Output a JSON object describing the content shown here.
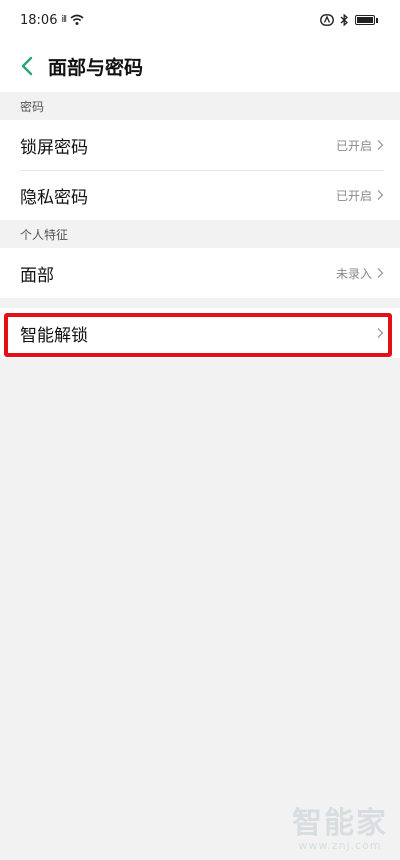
{
  "status_bar": {
    "time": "18:06",
    "signal": "ill",
    "icons": [
      "wifi-icon",
      "nfc-icon",
      "bluetooth-icon",
      "battery-icon"
    ]
  },
  "header": {
    "title": "面部与密码"
  },
  "sections": [
    {
      "title": "密码",
      "items": [
        {
          "label": "锁屏密码",
          "value": "已开启"
        },
        {
          "label": "隐私密码",
          "value": "已开启"
        }
      ]
    },
    {
      "title": "个人特征",
      "items": [
        {
          "label": "面部",
          "value": "未录入"
        }
      ]
    }
  ],
  "smart_unlock": {
    "label": "智能解锁"
  },
  "watermark": {
    "logo": "智能家",
    "url": "www.znj.com"
  },
  "colors": {
    "accent": "#2aa47e",
    "highlight": "#e3101a",
    "background": "#f2f2f2"
  }
}
